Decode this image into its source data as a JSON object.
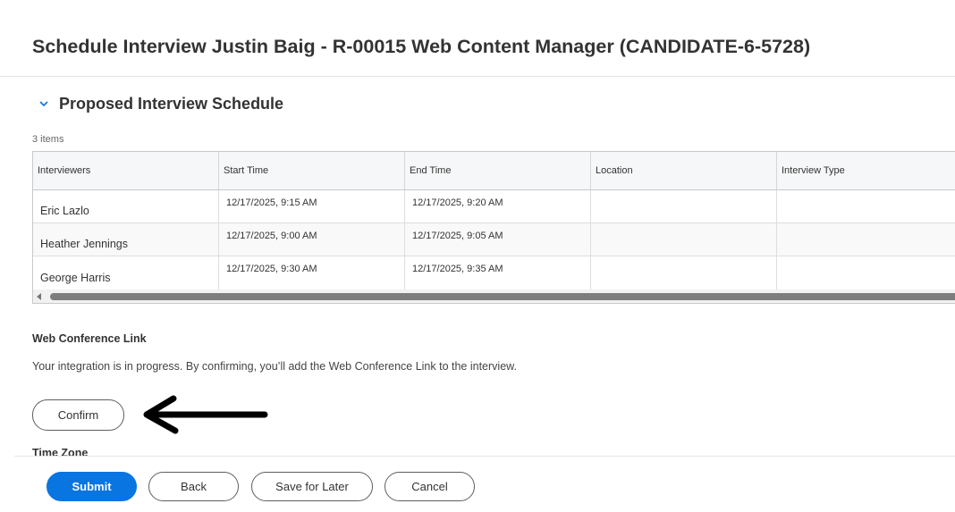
{
  "page": {
    "title": "Schedule Interview Justin Baig - R-00015 Web Content Manager (CANDIDATE-6-5728)"
  },
  "section": {
    "title": "Proposed Interview Schedule",
    "items_count": "3 items"
  },
  "table": {
    "headers": [
      "Interviewers",
      "Start Time",
      "End Time",
      "Location",
      "Interview Type"
    ],
    "rows": [
      {
        "interviewer": "Eric Lazlo",
        "start": "12/17/2025, 9:15 AM",
        "end": "12/17/2025, 9:20 AM",
        "location": "",
        "type": ""
      },
      {
        "interviewer": "Heather Jennings",
        "start": "12/17/2025, 9:00 AM",
        "end": "12/17/2025, 9:05 AM",
        "location": "",
        "type": ""
      },
      {
        "interviewer": "George Harris",
        "start": "12/17/2025, 9:30 AM",
        "end": "12/17/2025, 9:35 AM",
        "location": "",
        "type": ""
      }
    ]
  },
  "web_conference": {
    "label": "Web Conference Link",
    "text": "Your integration is in progress. By confirming, you’ll add the Web Conference Link to the interview.",
    "confirm_label": "Confirm"
  },
  "time_zone": {
    "label": "Time Zone"
  },
  "footer": {
    "submit_label": "Submit",
    "back_label": "Back",
    "save_label": "Save for Later",
    "cancel_label": "Cancel"
  },
  "icons": {
    "section_toggle": "chevron-down-icon",
    "annotation": "arrow-left-icon",
    "scroll": "scroll-left-icon"
  },
  "colors": {
    "primary": "#0875e1",
    "text": "#333333",
    "header_bg": "#f6f7f8"
  }
}
